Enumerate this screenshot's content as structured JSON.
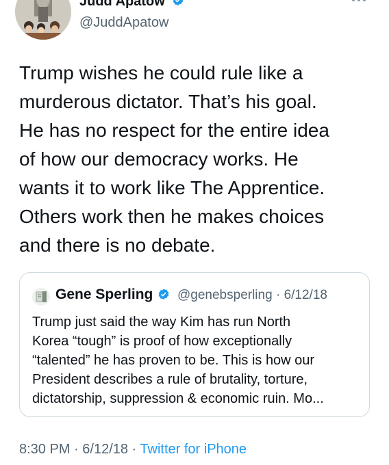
{
  "tweet": {
    "author": {
      "name": "Judd Apatow",
      "handle": "@JuddApatow"
    },
    "more_icon": "more-horizontal-icon",
    "text": "Trump wishes he could rule like a\nmurderous dictator. That’s his goal.\nHe has no respect for the entire idea\nof how our democracy works.  He\nwants it to work like The Apprentice.\nOthers work then he makes choices\nand there is no debate.",
    "quote": {
      "name": "Gene Sperling",
      "handle": "@genebsperling",
      "date": "6/12/18",
      "text": "Trump just said the way Kim has run North\nKorea “tough” is proof of how exceptionally\n“talented” he has proven to be. This is how our\nPresident describes a rule of brutality, torture,\ndictatorship, suppression & economic ruin. Mo..."
    },
    "time": "8:30 PM",
    "date": "6/12/18",
    "source": "Twitter for iPhone"
  },
  "colors": {
    "verified_blue": "#1d9bf0",
    "secondary_text": "#536471",
    "link": "#1d9bf0",
    "border": "#cfd9de"
  }
}
